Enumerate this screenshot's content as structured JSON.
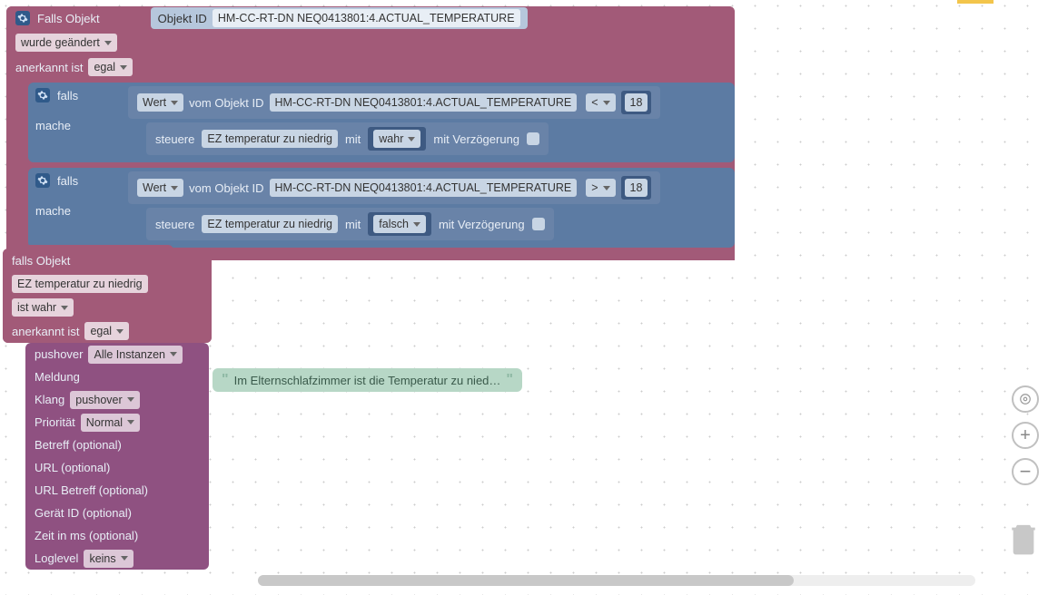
{
  "outer": {
    "title": "Falls Objekt",
    "objectIdLabel": "Objekt ID",
    "objectId": "HM-CC-RT-DN NEQ0413801:4.ACTUAL_TEMPERATURE",
    "changed": "wurde geändert",
    "ackLabel": "anerkannt ist",
    "ackValue": "egal"
  },
  "if1": {
    "falls": "falls",
    "mache": "mache",
    "wert": "Wert",
    "vom": "vom Objekt ID",
    "oid": "HM-CC-RT-DN NEQ0413801:4.ACTUAL_TEMPERATURE",
    "op": "<",
    "num": "18",
    "steuere": "steuere",
    "target": "EZ temperatur zu niedrig",
    "mit": "mit",
    "val": "wahr",
    "delay": "mit Verzögerung"
  },
  "if2": {
    "falls": "falls",
    "mache": "mache",
    "wert": "Wert",
    "vom": "vom Objekt ID",
    "oid": "HM-CC-RT-DN NEQ0413801:4.ACTUAL_TEMPERATURE",
    "op": ">",
    "num": "18",
    "steuere": "steuere",
    "target": "EZ temperatur zu niedrig",
    "mit": "mit",
    "val": "falsch",
    "delay": "mit Verzögerung"
  },
  "falls2": {
    "title": "falls Objekt",
    "obj": "EZ temperatur zu niedrig",
    "istWahr": "ist wahr",
    "ackLabel": "anerkannt ist",
    "ackValue": "egal"
  },
  "push": {
    "head": "pushover",
    "instance": "Alle Instanzen",
    "meldung": "Meldung",
    "klang": "Klang",
    "klangV": "pushover",
    "prio": "Priorität",
    "prioV": "Normal",
    "betreff": "Betreff (optional)",
    "url": "URL (optional)",
    "urlB": "URL Betreff (optional)",
    "gid": "Gerät ID (optional)",
    "zeit": "Zeit in ms (optional)",
    "logl": "Loglevel",
    "loglV": "keins"
  },
  "msg": "Im Elternschlafzimmer ist die Temperatur zu nied…"
}
